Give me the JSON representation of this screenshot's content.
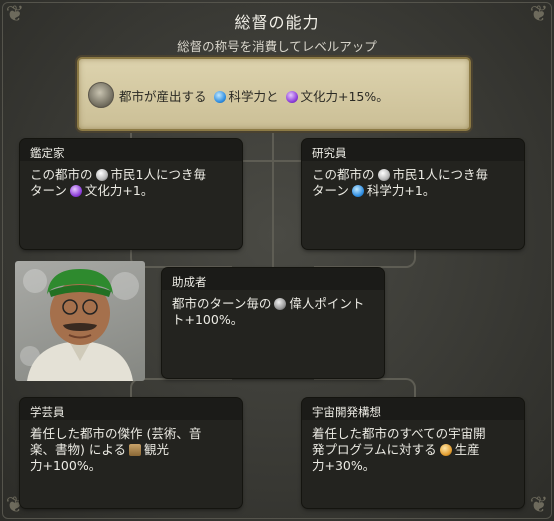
{
  "header": {
    "title": "総督の能力",
    "subtitle": "総督の称号を消費してレベルアップ"
  },
  "default_ability": {
    "text_before": "都市が産出する",
    "science": "科学力と",
    "culture": "文化力+15%。",
    "icons": [
      "governor-portrait-icon",
      "science-icon",
      "culture-icon"
    ]
  },
  "promotions": [
    {
      "title": "鑑定家",
      "line1": "この都市の",
      "line1b": "市民1人につき毎",
      "line2": "ターン",
      "line2b": "文化力+1。"
    },
    {
      "title": "研究員",
      "line1": "この都市の",
      "line1b": "市民1人につき毎",
      "line2": "ターン",
      "line2b": "科学力+1。"
    },
    {
      "title": "助成者",
      "line1": "都市のターン毎の",
      "line1b": "偉人ポイント",
      "line2": "ト+100%。"
    },
    {
      "title": "学芸員",
      "line1": "着任した都市の傑作 (芸術、音",
      "line2": "楽、書物) による",
      "line2b": "観光",
      "line3": "力+100%。"
    },
    {
      "title": "宇宙開発構想",
      "line1": "着任した都市のすべての宇宙開",
      "line2": "発プログラムに対する",
      "line2b": "生産",
      "line3": "力+30%。"
    }
  ],
  "colors": {
    "gold_bg": "#d6cca5",
    "card_bg": "#23231f",
    "panel_bg": "#3d3d38",
    "science": "#2c8be0",
    "culture": "#8a3ad8"
  }
}
